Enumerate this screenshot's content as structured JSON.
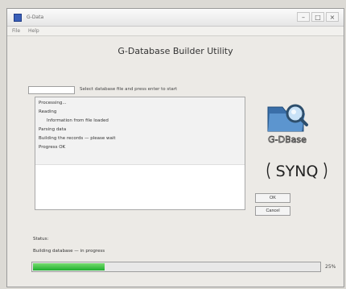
{
  "window": {
    "title": "G-Data",
    "controls": {
      "minimize": "–",
      "maximize": "□",
      "close": "×"
    }
  },
  "menubar": {
    "items": [
      "File",
      "Help"
    ]
  },
  "heading": "G-Database Builder Utility",
  "input": {
    "value": ""
  },
  "instruction": "Select database file and press enter to start",
  "log": {
    "lines": [
      {
        "text": "Processing...",
        "indent": false
      },
      {
        "text": "Reading",
        "indent": false
      },
      {
        "text": "Information from file loaded",
        "indent": true
      },
      {
        "text": "Parsing data",
        "indent": false
      },
      {
        "text": "Building the records — please wait",
        "indent": false
      },
      {
        "text": "Progress OK",
        "indent": false
      }
    ]
  },
  "logos": {
    "gdb_text": "G-DBase",
    "synq_text": "SYNQ"
  },
  "buttons": {
    "ok": "OK",
    "cancel": "Cancel"
  },
  "status": {
    "label": "Status:",
    "detail": "Building database — in progress"
  },
  "progress": {
    "value": 0.25,
    "percent_text": "25%"
  },
  "colors": {
    "accent": "#1fae2e",
    "logo_blue": "#3a6ea8"
  }
}
